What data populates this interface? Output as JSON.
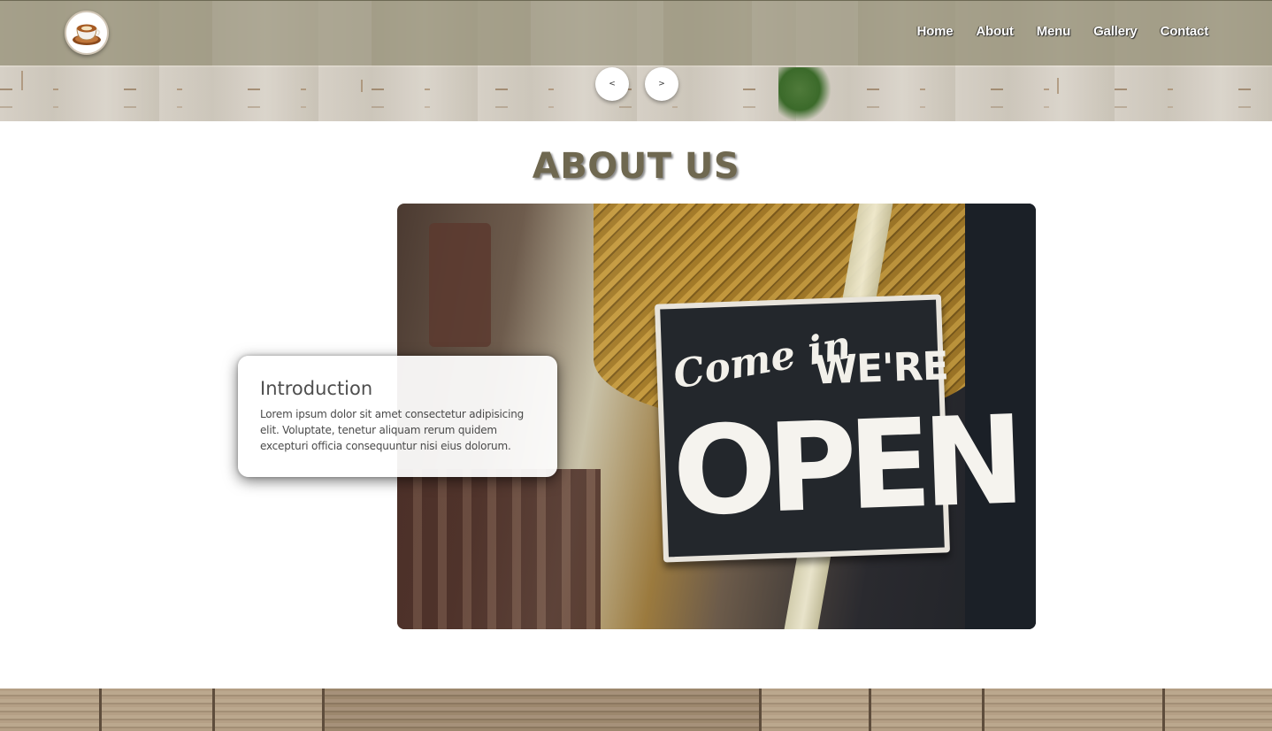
{
  "nav": {
    "logo_icon": "coffee-cup-icon",
    "links": [
      "Home",
      "About",
      "Menu",
      "Gallery",
      "Contact"
    ]
  },
  "slider": {
    "prev_label": "<",
    "next_label": ">"
  },
  "about": {
    "title": "ABOUT US",
    "photo_sign": {
      "script": "Come in",
      "line1": "WE'RE",
      "line2": "OPEN"
    },
    "intro": {
      "heading": "Introduction",
      "body": "Lorem ipsum dolor sit amet consectetur adipisicing elit. Voluptate, tenetur aliquam rerum quidem excepturi officia consequuntur nisi eius dolorum."
    }
  },
  "colors": {
    "navbar": "#948e76",
    "title": "#6f6850",
    "accent_wood": "#a8957c"
  }
}
